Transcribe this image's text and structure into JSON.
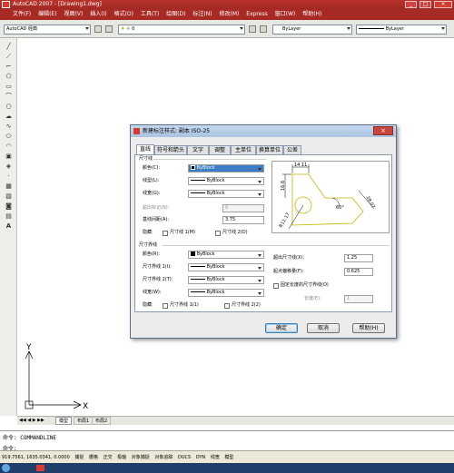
{
  "titlebar": {
    "title": "AutoCAD 2007 - [Drawing1.dwg]"
  },
  "menu": [
    "文件(F)",
    "编辑(E)",
    "视图(V)",
    "插入(I)",
    "格式(O)",
    "工具(T)",
    "绘图(D)",
    "标注(N)",
    "修改(M)",
    "Express",
    "窗口(W)",
    "帮助(H)"
  ],
  "toolbar": {
    "workspace": "AutoCAD 经典",
    "layer": "0",
    "color": "ByLayer",
    "linetype": "ByLayer"
  },
  "dialog": {
    "title": "新建标注样式: 副本 ISO-25",
    "tabs": [
      "直线",
      "符号和箭头",
      "文字",
      "调整",
      "主单位",
      "换算单位",
      "公差"
    ],
    "dimline": {
      "group": "尺寸线",
      "color_label": "颜色(C):",
      "color_value": "ByBlock",
      "linetype_label": "线型(L):",
      "linetype_value": "ByBlock",
      "lineweight_label": "线宽(G):",
      "lineweight_value": "ByBlock",
      "extend_label": "超出标记(N):",
      "extend_value": "0",
      "baseline_label": "基线间距(A):",
      "baseline_value": "3.75",
      "suppress_label": "隐藏:",
      "suppress1": "尺寸线 1(M)",
      "suppress2": "尺寸线 2(D)"
    },
    "extline": {
      "group": "尺寸界线",
      "color_label": "颜色(R):",
      "color_value": "ByBlock",
      "lt1_label": "尺寸界线 1(I):",
      "lt1_value": "ByBlock",
      "lt2_label": "尺寸界线 2(T):",
      "lt2_value": "ByBlock",
      "lw_label": "线宽(W):",
      "lw_value": "ByBlock",
      "suppress_label": "隐藏:",
      "suppress1": "尺寸界线 1(1)",
      "suppress2": "尺寸界线 2(2)",
      "beyond_label": "超出尺寸线(X):",
      "beyond_value": "1.25",
      "offset_label": "起点偏移量(F):",
      "offset_value": "0.625",
      "fixed_label": "固定长度的尺寸界线(O)",
      "length_label": "长度(E):",
      "length_value": "1"
    },
    "preview": {
      "dim_top": "14.11",
      "dim_left": "16.6",
      "dim_right": "28.07",
      "dim_angle": "60°",
      "dim_radius": "R11.17"
    },
    "buttons": {
      "ok": "确定",
      "cancel": "取消",
      "help": "帮助(H)"
    }
  },
  "tabs": {
    "model": "模型",
    "layout1": "布局1",
    "layout2": "布局2"
  },
  "cmd": {
    "line1": "命令: COMMANDLINE",
    "line2": "命令:"
  },
  "status": {
    "coords": "919.7561, 1635.0341, 0.0000",
    "items": [
      "捕捉",
      "栅格",
      "正交",
      "极轴",
      "对象捕捉",
      "对象追踪",
      "DUCS",
      "DYN",
      "线宽",
      "模型"
    ]
  },
  "colors": {
    "title": "#b9332c",
    "menu": "#a72a24",
    "accent": "#3c7fb1",
    "preview_line": "#c9b400"
  }
}
